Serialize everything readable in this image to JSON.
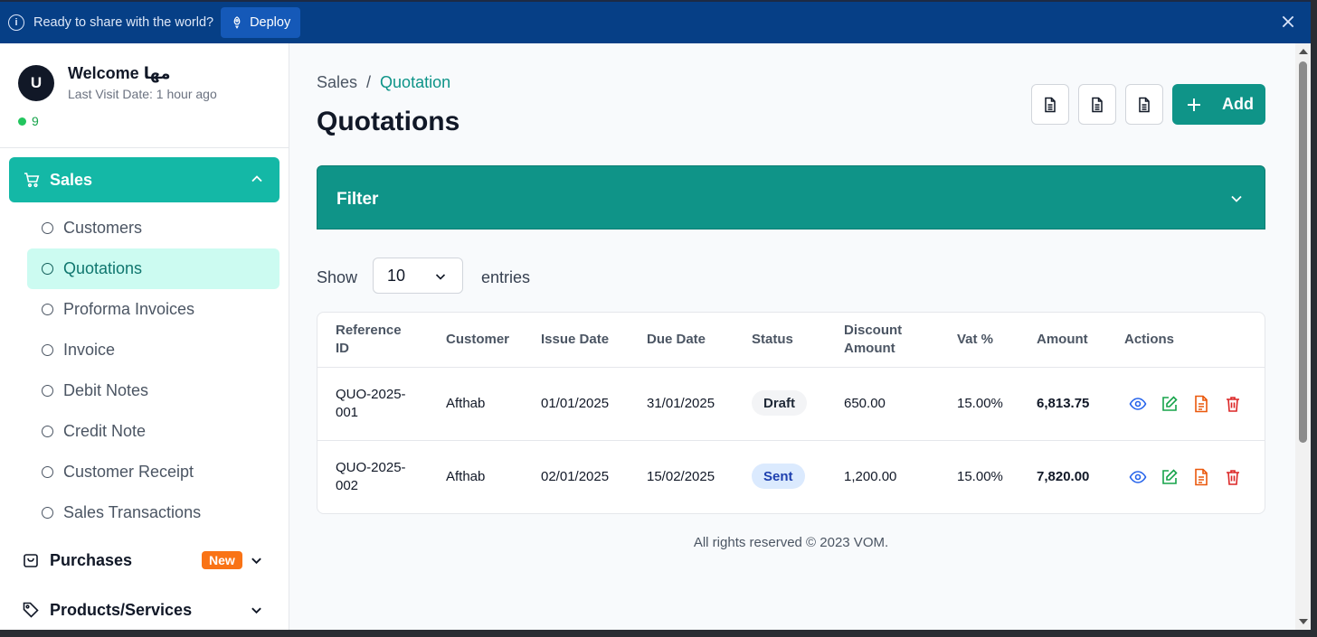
{
  "banner": {
    "message": "Ready to share with the world?",
    "deploy_label": "Deploy"
  },
  "profile": {
    "avatar_initial": "U",
    "welcome": "Welcome مها",
    "last_visit": "Last Visit Date: 1 hour ago",
    "online_count": "9"
  },
  "sidebar": {
    "sales_label": "Sales",
    "sales_items": [
      {
        "label": "Customers"
      },
      {
        "label": "Quotations"
      },
      {
        "label": "Proforma Invoices"
      },
      {
        "label": "Invoice"
      },
      {
        "label": "Debit Notes"
      },
      {
        "label": "Credit Note"
      },
      {
        "label": "Customer Receipt"
      },
      {
        "label": "Sales Transactions"
      }
    ],
    "purchases_label": "Purchases",
    "purchases_badge": "New",
    "products_label": "Products/Services"
  },
  "breadcrumb": {
    "parent": "Sales",
    "separator": "/",
    "current": "Quotation"
  },
  "page_title": "Quotations",
  "add_label": "Add",
  "filter_label": "Filter",
  "entries": {
    "show": "Show",
    "value": "10",
    "suffix": "entries"
  },
  "table": {
    "headers": [
      "Reference ID",
      "Customer",
      "Issue Date",
      "Due Date",
      "Status",
      "Discount Amount",
      "Vat %",
      "Amount",
      "Actions"
    ],
    "rows": [
      {
        "ref_line1": "QUO-2025-",
        "ref_line2": "001",
        "customer": "Afthab",
        "issue": "01/01/2025",
        "due": "31/01/2025",
        "status": "Draft",
        "discount": "650.00",
        "vat": "15.00%",
        "amount": "6,813.75"
      },
      {
        "ref_line1": "QUO-2025-",
        "ref_line2": "002",
        "customer": "Afthab",
        "issue": "02/01/2025",
        "due": "15/02/2025",
        "status": "Sent",
        "discount": "1,200.00",
        "vat": "15.00%",
        "amount": "7,820.00"
      }
    ]
  },
  "footer": "All rights reserved © 2023 VOM.",
  "colors": {
    "brand": "#0f9488",
    "active_nav": "#14b8a6",
    "banner": "#063f86",
    "badge": "#f97316"
  }
}
